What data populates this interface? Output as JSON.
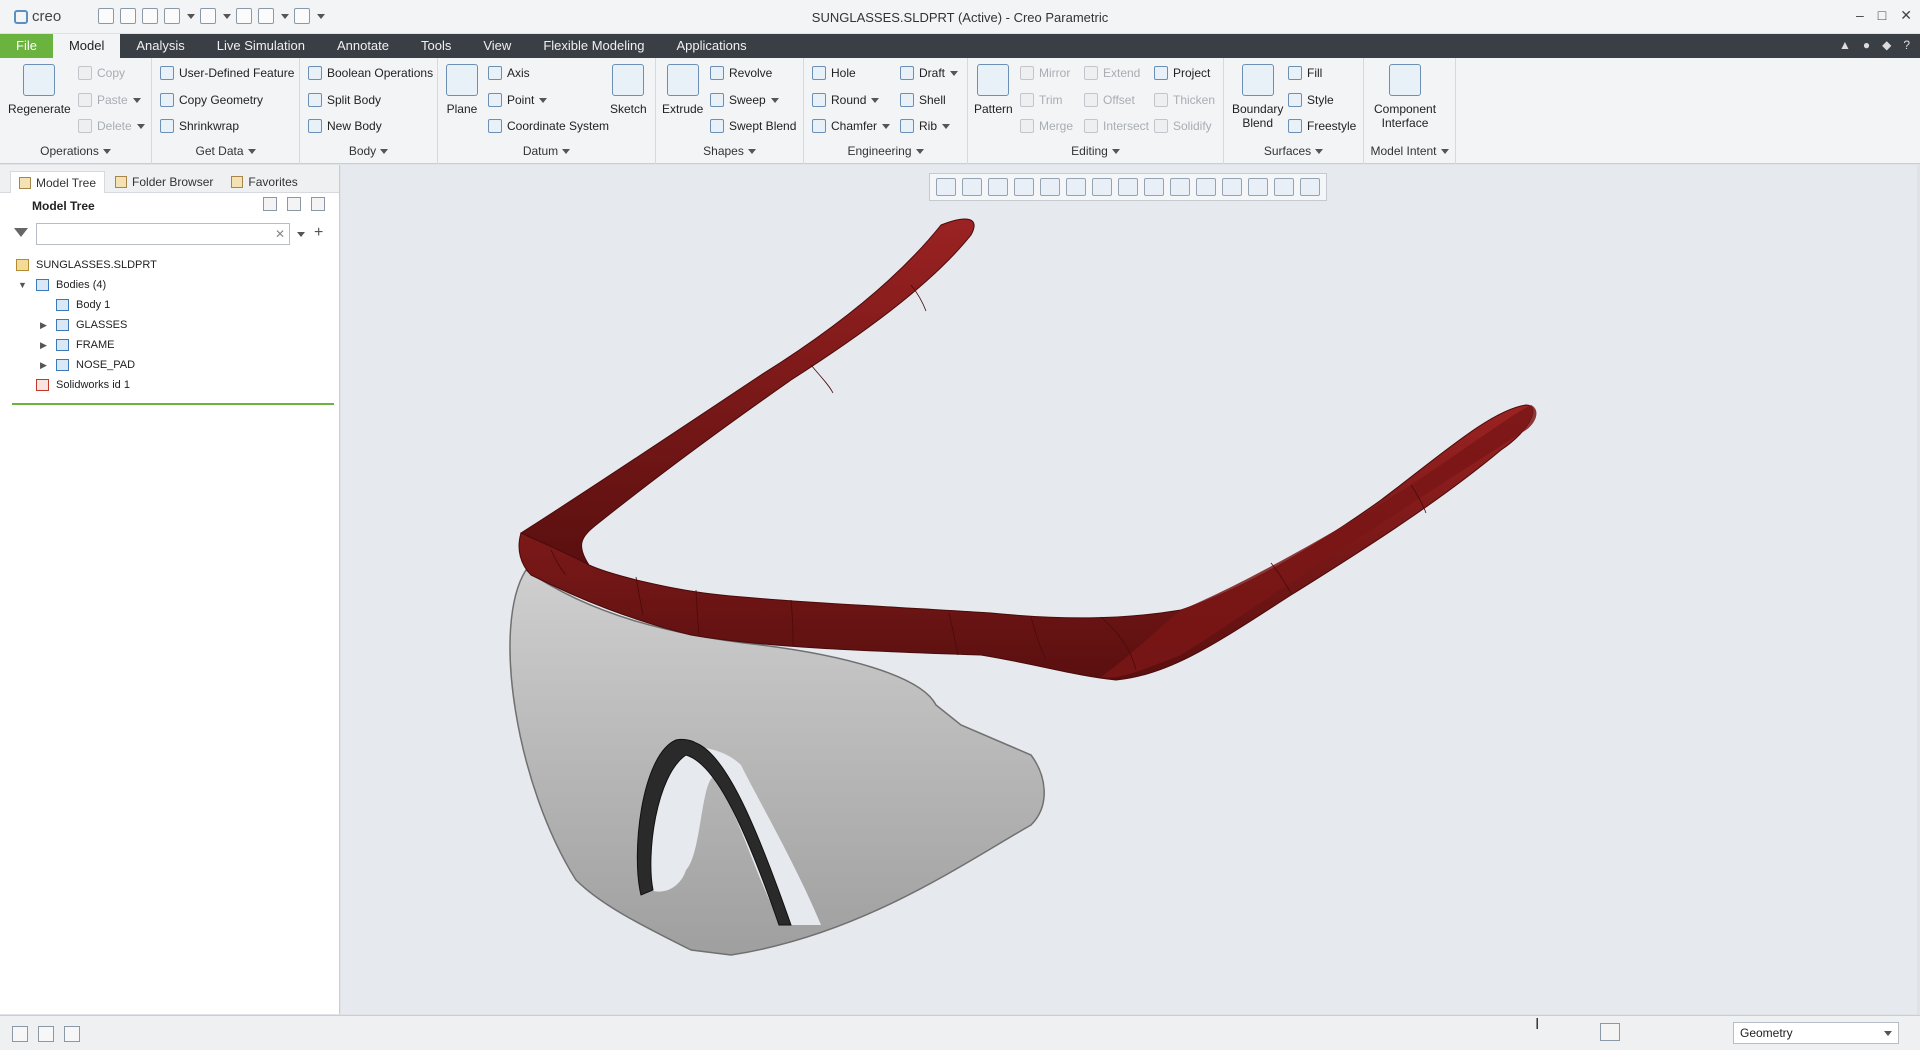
{
  "app": {
    "name": "creo",
    "window_title": "SUNGLASSES.SLDPRT (Active) - Creo Parametric",
    "window_controls": [
      "–",
      "□",
      "✕"
    ]
  },
  "menu": {
    "file": "File",
    "tabs": [
      "Model",
      "Analysis",
      "Live Simulation",
      "Annotate",
      "Tools",
      "View",
      "Flexible Modeling",
      "Applications"
    ]
  },
  "ribbon": {
    "operations": {
      "name": "Operations",
      "regenerate": "Regenerate",
      "copy": "Copy",
      "paste": "Paste",
      "delete": "Delete"
    },
    "get_data": {
      "name": "Get Data",
      "udf": "User-Defined Feature",
      "copy_geometry": "Copy Geometry",
      "shrinkwrap": "Shrinkwrap"
    },
    "body": {
      "name": "Body",
      "boolean": "Boolean Operations",
      "split": "Split Body",
      "new": "New Body"
    },
    "datum": {
      "name": "Datum",
      "plane": "Plane",
      "axis": "Axis",
      "point": "Point",
      "csys": "Coordinate System",
      "sketch": "Sketch"
    },
    "shapes": {
      "name": "Shapes",
      "extrude": "Extrude",
      "revolve": "Revolve",
      "sweep": "Sweep",
      "swept_blend": "Swept Blend"
    },
    "engineering": {
      "name": "Engineering",
      "hole": "Hole",
      "round": "Round",
      "chamfer": "Chamfer",
      "draft": "Draft",
      "shell": "Shell",
      "rib": "Rib"
    },
    "editing": {
      "name": "Editing",
      "pattern": "Pattern",
      "mirror": "Mirror",
      "trim": "Trim",
      "merge": "Merge",
      "extend": "Extend",
      "offset": "Offset",
      "intersect": "Intersect",
      "project": "Project",
      "thicken": "Thicken",
      "solidify": "Solidify"
    },
    "surfaces": {
      "name": "Surfaces",
      "boundary_blend_1": "Boundary",
      "boundary_blend_2": "Blend",
      "fill": "Fill",
      "style": "Style",
      "freestyle": "Freestyle"
    },
    "model_intent": {
      "name": "Model Intent",
      "component_1": "Component",
      "component_2": "Interface"
    }
  },
  "left_panel": {
    "tabs": [
      "Model Tree",
      "Folder Browser",
      "Favorites"
    ],
    "tree_title": "Model Tree",
    "search": {
      "value": "",
      "placeholder": ""
    },
    "tree": {
      "root": "SUNGLASSES.SLDPRT",
      "bodies": "Bodies (4)",
      "body1": "Body 1",
      "glasses": "GLASSES",
      "frame": "FRAME",
      "nose_pad": "NOSE_PAD",
      "sw_id": "Solidworks id 1"
    }
  },
  "status": {
    "selection_filter": "Geometry"
  },
  "colors": {
    "frame": "#8b1a1a",
    "lens": "#b5b5b5",
    "nose_pad": "#2a2a2a",
    "file_tab": "#6ab33e",
    "menubar": "#3a3f45"
  }
}
